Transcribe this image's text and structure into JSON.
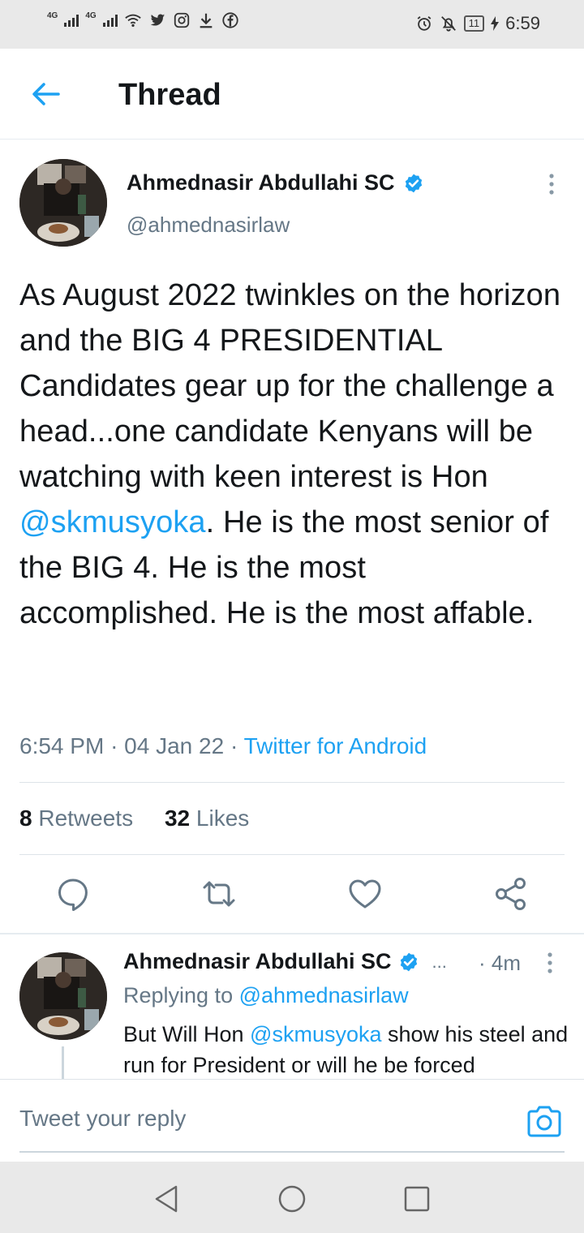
{
  "status_bar": {
    "network_1": "4G",
    "network_2": "4G",
    "left_icons": [
      "wifi-icon",
      "twitter-bird-icon",
      "instagram-icon",
      "download-icon",
      "facebook-icon"
    ],
    "right_icons": [
      "alarm-icon",
      "mute-icon"
    ],
    "battery": "11",
    "time": "6:59"
  },
  "header": {
    "title": "Thread"
  },
  "tweet": {
    "author_name": "Ahmednasir Abdullahi SC",
    "handle": "@ahmednasirlaw",
    "text_before": "As August 2022 twinkles on the horizon and the BIG 4 PRESIDENTIAL Candidates gear up for the challenge a head...one candidate Kenyans will be watching with keen interest is Hon ",
    "mention": "@skmusyoka",
    "text_after": ". He is the most senior of the BIG 4. He is the most accomplished. He is the most affable.",
    "time": "6:54 PM",
    "date": "04 Jan 22",
    "source": "Twitter for Android",
    "retweets_count": "8",
    "retweets_label": "Retweets",
    "likes_count": "32",
    "likes_label": "Likes"
  },
  "reply": {
    "author_name": "Ahmednasir Abdullahi SC",
    "ellipsis": "...",
    "time": "4m",
    "replying_prefix": "Replying to",
    "replying_handle": "@ahmednasirlaw",
    "text_before": "But Will Hon ",
    "mention": "@skmusyoka",
    "text_after": " show his steel and run for President or will he be forced"
  },
  "composer": {
    "placeholder": "Tweet your reply"
  },
  "colors": {
    "accent": "#1da1f2",
    "secondary_text": "#657786",
    "primary_text": "#14171a"
  }
}
